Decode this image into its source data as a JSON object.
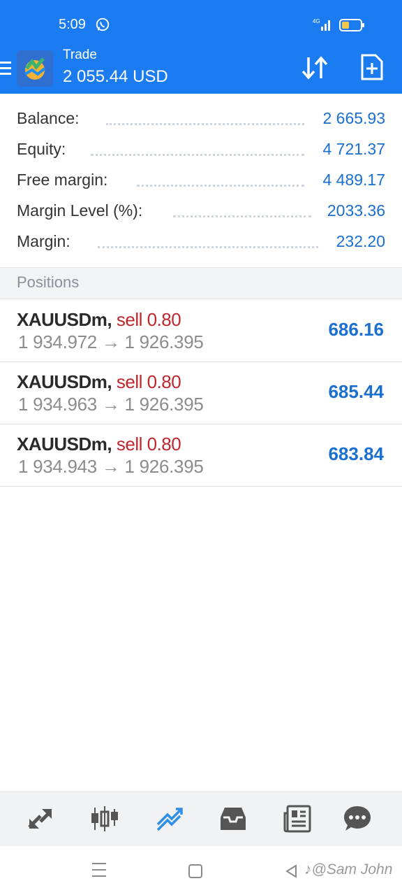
{
  "status": {
    "time": "5:09",
    "network": "4G"
  },
  "header": {
    "title": "Trade",
    "balance": "2 055.44 USD"
  },
  "summary": [
    {
      "label": "Balance:",
      "value": "2 665.93"
    },
    {
      "label": "Equity:",
      "value": "4 721.37"
    },
    {
      "label": "Free margin:",
      "value": "4 489.17"
    },
    {
      "label": "Margin Level (%):",
      "value": "2033.36"
    },
    {
      "label": "Margin:",
      "value": "232.20"
    }
  ],
  "positions_header": "Positions",
  "positions": [
    {
      "symbol": "XAUUSDm",
      "side": "sell 0.80",
      "open": "1 934.972",
      "arrow": "→",
      "current": "1 926.395",
      "profit": "686.16"
    },
    {
      "symbol": "XAUUSDm",
      "side": "sell 0.80",
      "open": "1 934.963",
      "arrow": "→",
      "current": "1 926.395",
      "profit": "685.44"
    },
    {
      "symbol": "XAUUSDm",
      "side": "sell 0.80",
      "open": "1 934.943",
      "arrow": "→",
      "current": "1 926.395",
      "profit": "683.84"
    }
  ],
  "tabs": [
    {
      "icon": "quotes-icon",
      "active": false
    },
    {
      "icon": "chart-icon",
      "active": false
    },
    {
      "icon": "trade-icon",
      "active": true
    },
    {
      "icon": "history-icon",
      "active": false
    },
    {
      "icon": "news-icon",
      "active": false
    },
    {
      "icon": "messages-icon",
      "active": false
    }
  ],
  "watermark": "♪@Sam John",
  "colors": {
    "primary": "#1a7cf0",
    "profit": "#1a6fd0",
    "sell": "#c0262d"
  }
}
